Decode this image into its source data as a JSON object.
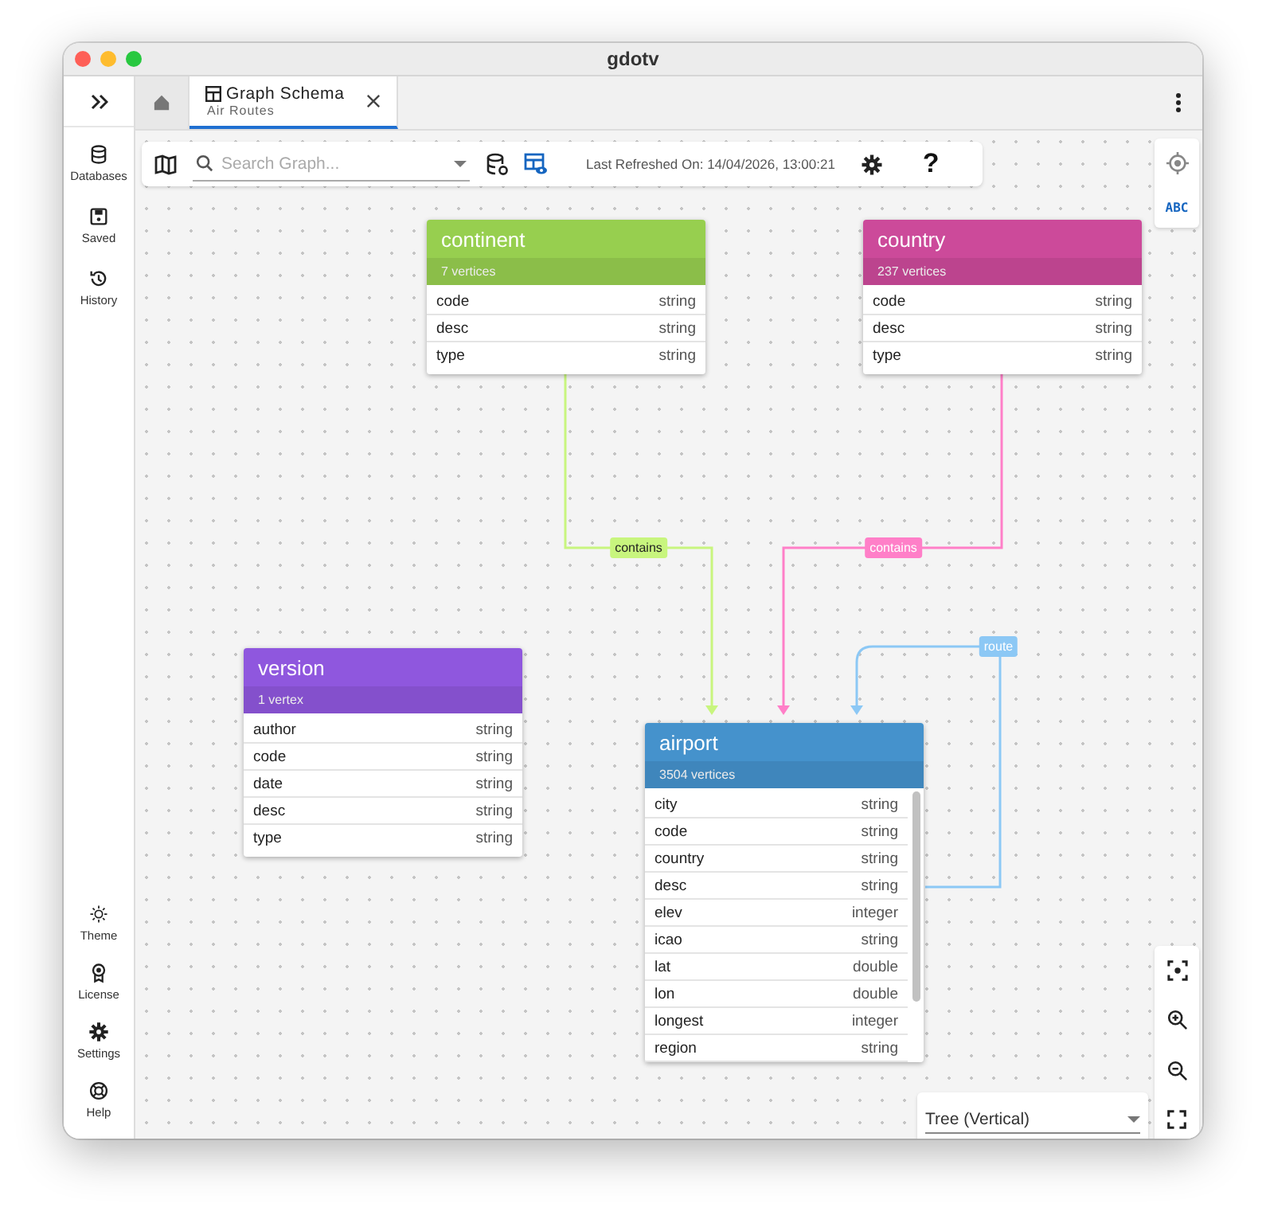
{
  "window": {
    "title": "gdotv"
  },
  "sidebar": {
    "top_items": [
      {
        "label": "Databases"
      },
      {
        "label": "Saved"
      },
      {
        "label": "History"
      }
    ],
    "bottom_items": [
      {
        "label": "Theme"
      },
      {
        "label": "License"
      },
      {
        "label": "Settings"
      },
      {
        "label": "Help"
      }
    ]
  },
  "tabs": [
    {
      "kind": "home",
      "selected": false
    },
    {
      "kind": "page",
      "title": "Graph Schema",
      "subtitle": "Air Routes",
      "selected": true
    }
  ],
  "toolbar": {
    "search": {
      "placeholder": "Search Graph..."
    },
    "last_refreshed": "Last Refreshed On: 14/04/2026, 13:00:21",
    "help": "?"
  },
  "side_panel": {
    "label_toggle": "ABC"
  },
  "layout_select": {
    "value": "Tree (Vertical)"
  },
  "nodes": [
    {
      "name": "continent",
      "count": "7 vertices",
      "color": "#97cf4f",
      "properties": [
        {
          "name": "code",
          "type": "string"
        },
        {
          "name": "desc",
          "type": "string"
        },
        {
          "name": "type",
          "type": "string"
        }
      ]
    },
    {
      "name": "country",
      "count": "237 vertices",
      "color": "#cc4a9a",
      "properties": [
        {
          "name": "code",
          "type": "string"
        },
        {
          "name": "desc",
          "type": "string"
        },
        {
          "name": "type",
          "type": "string"
        }
      ]
    },
    {
      "name": "version",
      "count": "1 vertex",
      "color": "#8f57de",
      "properties": [
        {
          "name": "author",
          "type": "string"
        },
        {
          "name": "code",
          "type": "string"
        },
        {
          "name": "date",
          "type": "string"
        },
        {
          "name": "desc",
          "type": "string"
        },
        {
          "name": "type",
          "type": "string"
        }
      ]
    },
    {
      "name": "airport",
      "count": "3504 vertices",
      "color": "#4592cc",
      "properties": [
        {
          "name": "city",
          "type": "string"
        },
        {
          "name": "code",
          "type": "string"
        },
        {
          "name": "country",
          "type": "string"
        },
        {
          "name": "desc",
          "type": "string"
        },
        {
          "name": "elev",
          "type": "integer"
        },
        {
          "name": "icao",
          "type": "string"
        },
        {
          "name": "lat",
          "type": "double"
        },
        {
          "name": "lon",
          "type": "double"
        },
        {
          "name": "longest",
          "type": "integer"
        },
        {
          "name": "region",
          "type": "string"
        }
      ]
    }
  ],
  "edges": [
    {
      "label": "contains",
      "color": "#c8f57e"
    },
    {
      "label": "contains",
      "color": "#ff7fc8"
    },
    {
      "label": "route",
      "color": "#8cc8f5"
    }
  ]
}
